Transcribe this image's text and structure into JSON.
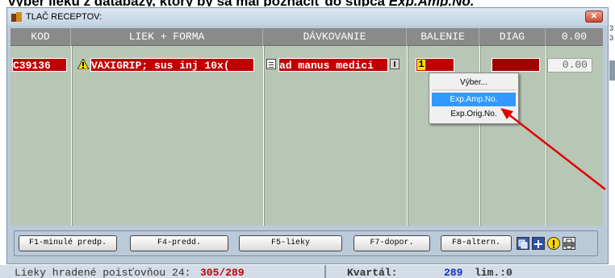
{
  "top_text": {
    "left": "výber lieku z databázy, ",
    "middle": "ktorý by sa mal poznačiť",
    "right": " do stĺpca  ",
    "emph": "Exp.Amp.No."
  },
  "window": {
    "title": "TLAČ RECEPTOV:",
    "close_label": "✕"
  },
  "columns": [
    {
      "label": "KOD"
    },
    {
      "label": "LIEK + FORMA"
    },
    {
      "label": "DÁVKOVANIE"
    },
    {
      "label": "BALENIE"
    },
    {
      "label": "DIAG"
    },
    {
      "label": "0.00"
    }
  ],
  "row": {
    "kod": "C39136",
    "liek": "VAXIGRIP; sus inj 10x(",
    "davkovanie": "ad manus medici",
    "balenie": "1",
    "diag": "",
    "suma": "0.00"
  },
  "context_menu": {
    "items": [
      {
        "label": "Výber..."
      },
      {
        "label": "Exp.Amp.No."
      },
      {
        "label": "Exp.Orig.No."
      }
    ],
    "highlighted_index": 1
  },
  "buttons": [
    {
      "label": "F1-minulé predp."
    },
    {
      "label": "F4-predd."
    },
    {
      "label": "F5-lieky"
    },
    {
      "label": "F7-dopor."
    },
    {
      "label": "F8-altern."
    }
  ],
  "status": {
    "lieky_label": "Lieky hradené poisťovňou 24:",
    "lieky_value": "305/289",
    "kvartal_label": "Kvartál:",
    "kvartal_value": "289",
    "lim_label": "lim.:0"
  },
  "right_edge": {
    "a": "3",
    "b": "3"
  },
  "colors": {
    "accent_red": "#c00000",
    "menu_highlight": "#3399ff",
    "arrow": "#e00000"
  }
}
